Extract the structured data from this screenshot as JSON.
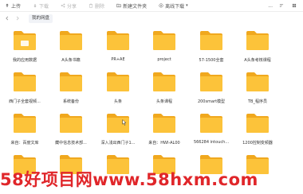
{
  "toolbar": {
    "upload": "上传",
    "download": "下载",
    "share": "分享",
    "delete": "删除",
    "new_folder": "新建文件夹",
    "offline": "离线下载",
    "more": "..."
  },
  "path": {
    "current": "我的网盘"
  },
  "folders": [
    "我的应用数据",
    "A头条书籍",
    "PR+AE",
    "project",
    "57-1500全套",
    "A头条考核课程",
    "西门子全套视频...",
    "系统备份",
    "头条",
    "头条课程",
    "200smart模型",
    "TB_程序员",
    "来自：百度文库",
    "藏中信息技术部...",
    "深入浅出西门子1...",
    "来自：HWI-AL00",
    "566284 intouch...",
    "1200控制变频器"
  ],
  "watermark": {
    "text": "58好项目网www.58hxm.com"
  },
  "colors": {
    "folder_body": "#fcc33a",
    "folder_back": "#f0a81e",
    "watermark": "#e0262a"
  }
}
